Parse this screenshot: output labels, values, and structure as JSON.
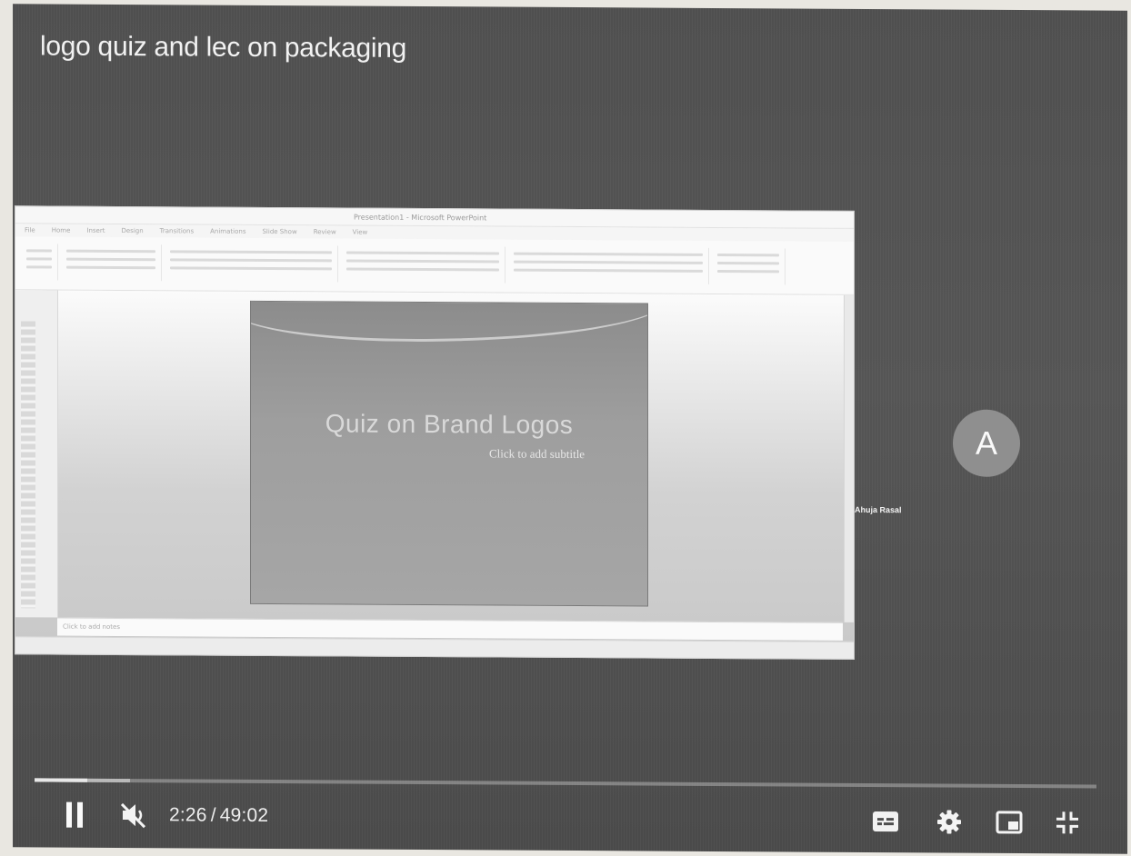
{
  "video": {
    "title": "logo quiz and lec on packaging"
  },
  "shared_screen": {
    "window_title": "Presentation1 - Microsoft PowerPoint",
    "ribbon_tabs": [
      "File",
      "Home",
      "Insert",
      "Design",
      "Transitions",
      "Animations",
      "Slide Show",
      "Review",
      "View"
    ],
    "slide_title": "Quiz on Brand Logos",
    "slide_subtitle": "Click to add subtitle",
    "notes_placeholder": "Click to add notes"
  },
  "participant": {
    "avatar_initial": "A",
    "name": "Ahuja Rasal"
  },
  "player": {
    "current_time": "2:26",
    "separator": "/",
    "duration": "49:02",
    "progress_fraction": 0.0496,
    "buffered_fraction": 0.09,
    "muted": true,
    "playing": true
  },
  "controls": {
    "pause_icon": "pause-icon",
    "mute_icon": "volume-muted-icon",
    "cc_icon": "closed-captions-icon",
    "settings_icon": "gear-icon",
    "miniplayer_icon": "miniplayer-icon",
    "exit_fullscreen_icon": "exit-fullscreen-icon"
  }
}
